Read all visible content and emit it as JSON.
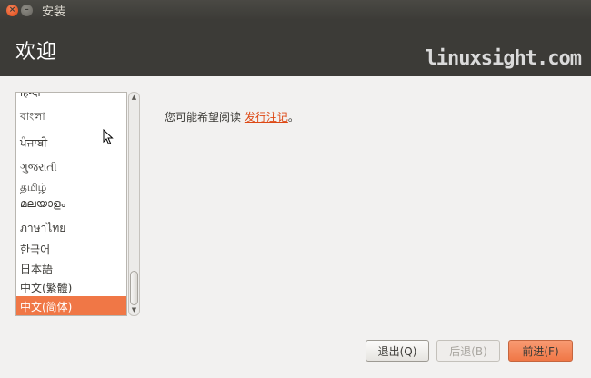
{
  "window": {
    "title": "安装"
  },
  "header": {
    "title": "欢迎",
    "watermark": "linuxsight.com"
  },
  "languages": [
    {
      "label": "हिन्दी",
      "selected": false
    },
    {
      "label": "বাংলা",
      "selected": false
    },
    {
      "label": "ਪੰਜਾਬੀ",
      "selected": false
    },
    {
      "label": "ગુજરાતી",
      "selected": false
    },
    {
      "label": "தமிழ்",
      "selected": false
    },
    {
      "label": "മലയാളം",
      "selected": false
    },
    {
      "label": "ภาษาไทย",
      "selected": false
    },
    {
      "label": "한국어",
      "selected": false
    },
    {
      "label": "日本語",
      "selected": false
    },
    {
      "label": "中文(繁體)",
      "selected": false
    },
    {
      "label": "中文(简体)",
      "selected": true
    }
  ],
  "main": {
    "notes_prefix": "您可能希望阅读 ",
    "notes_link": "发行注记",
    "notes_suffix": "。"
  },
  "buttons": {
    "quit": "退出(Q)",
    "back": "后退(B)",
    "forward": "前进(F)"
  },
  "colors": {
    "accent": "#f07746",
    "header": "#3c3b37",
    "link": "#dd4814"
  }
}
